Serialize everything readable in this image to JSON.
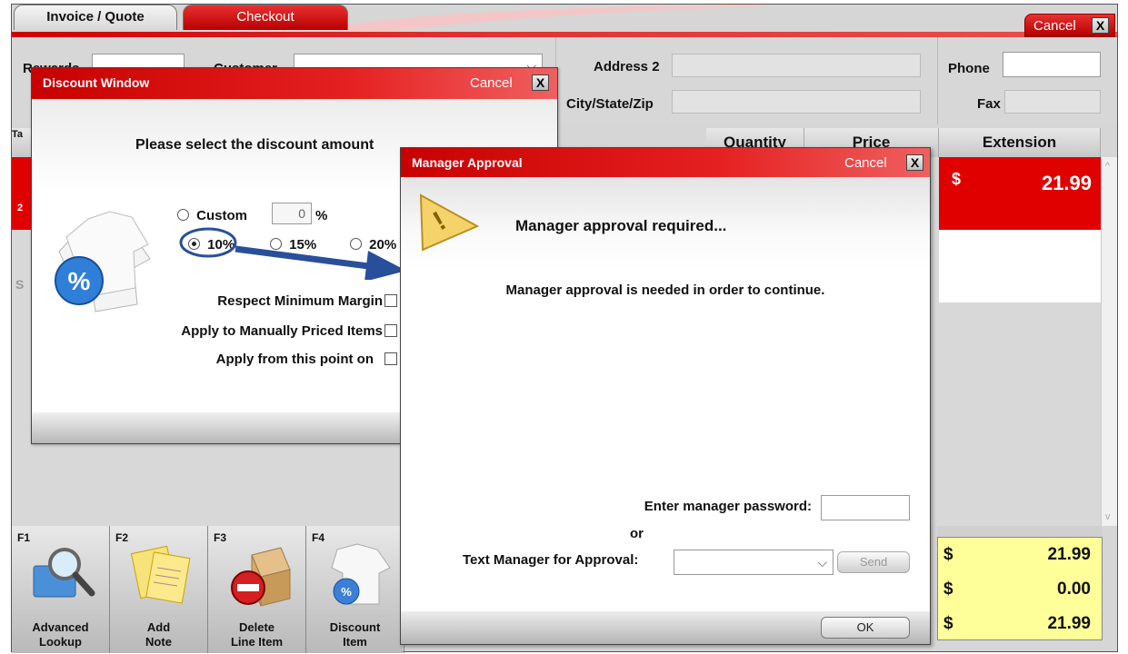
{
  "tabs": {
    "invoice_quote": "Invoice / Quote",
    "checkout": "Checkout"
  },
  "window": {
    "cancel_label": "Cancel",
    "close_glyph": "X"
  },
  "header": {
    "rewards_label": "Rewards",
    "customer_label": "Customer",
    "address2_label": "Address 2",
    "city_state_zip_label": "City/State/Zip",
    "phone_label": "Phone",
    "fax_label": "Fax",
    "customer_dropdown_glyph": "⌵"
  },
  "grid": {
    "columns": [
      "Quantity",
      "Price",
      "Extension"
    ],
    "row1": {
      "currency": "$",
      "extension": "21.99"
    },
    "left_fragments": [
      "Ta",
      "2",
      "S"
    ]
  },
  "fkeys": [
    {
      "key": "F1",
      "label_line1": "Advanced",
      "label_line2": "Lookup",
      "icon": "magnifier-icon"
    },
    {
      "key": "F2",
      "label_line1": "Add",
      "label_line2": "Note",
      "icon": "notes-icon"
    },
    {
      "key": "F3",
      "label_line1": "Delete",
      "label_line2": "Line Item",
      "icon": "delete-box-icon"
    },
    {
      "key": "F4",
      "label_line1": "Discount",
      "label_line2": "Item",
      "icon": "discount-shirt-icon"
    }
  ],
  "totals": [
    {
      "currency": "$",
      "amount": "21.99"
    },
    {
      "currency": "$",
      "amount": "0.00"
    },
    {
      "currency": "$",
      "amount": "21.99"
    }
  ],
  "discount_window": {
    "title": "Discount Window",
    "cancel_label": "Cancel",
    "close_glyph": "X",
    "prompt": "Please select the discount amount",
    "custom_label": "Custom",
    "custom_value": "0",
    "percent_sign": "%",
    "options": [
      "10%",
      "15%",
      "20%"
    ],
    "selected_option": "10%",
    "respect_min_margin": "Respect Minimum Margin",
    "apply_manually_priced": "Apply to Manually Priced Items",
    "apply_from_point": "Apply from this point on",
    "percent_icon_text": "%"
  },
  "manager_approval": {
    "title": "Manager Approval",
    "cancel_label": "Cancel",
    "close_glyph": "X",
    "heading": "Manager approval required...",
    "message": "Manager approval is needed in order to continue.",
    "password_label": "Enter manager password:",
    "password_value": "",
    "or_label": "or",
    "text_manager_label": "Text Manager for Approval:",
    "text_manager_value": "",
    "send_label": "Send",
    "ok_label": "OK",
    "dropdown_glyph": "⌵",
    "warning_icon_glyph": "!"
  },
  "colors": {
    "brand_red": "#e00000",
    "totals_yellow": "#ffff99",
    "annotation_blue": "#2a4f9a"
  }
}
